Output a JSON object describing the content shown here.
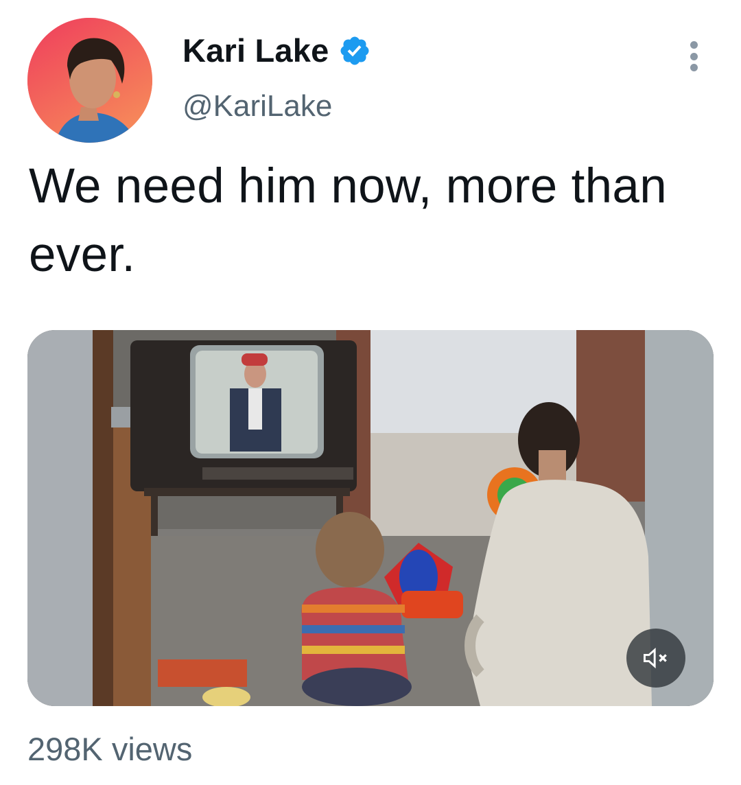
{
  "author": {
    "name": "Kari Lake",
    "handle": "@KariLake",
    "verified": true
  },
  "tweet": {
    "text": "We need him now, more than ever."
  },
  "media": {
    "type": "video",
    "muted": true
  },
  "stats": {
    "views": "298K views"
  },
  "icons": {
    "verified": "verified-badge-icon",
    "more": "more-options-icon",
    "mute": "volume-muted-icon"
  },
  "colors": {
    "verified_blue": "#1d9bf0",
    "text_primary": "#0f1419",
    "text_secondary": "#536471"
  }
}
